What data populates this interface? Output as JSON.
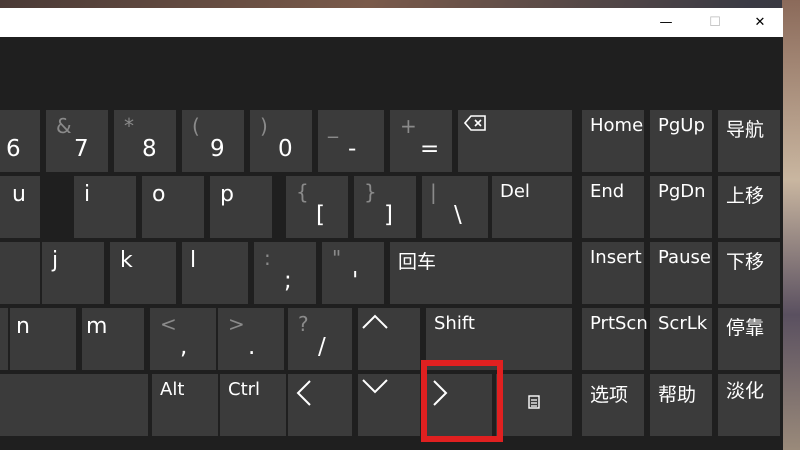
{
  "window": {
    "minimize_glyph": "—",
    "maximize_glyph": "☐",
    "close_glyph": "✕"
  },
  "keys": {
    "k6": {
      "bottom": "6"
    },
    "k7": {
      "top": "&",
      "bottom": "7"
    },
    "k8": {
      "top": "*",
      "bottom": "8"
    },
    "k9": {
      "top": "(",
      "bottom": "9"
    },
    "k0": {
      "top": ")",
      "bottom": "0"
    },
    "minus": {
      "top": "_",
      "bottom": "-"
    },
    "equals": {
      "top": "+",
      "bottom": "="
    },
    "backspace": {
      "icon": "backspace-icon"
    },
    "u": {
      "label": "u"
    },
    "i": {
      "label": "i"
    },
    "o": {
      "label": "o"
    },
    "p": {
      "label": "p"
    },
    "lbracket": {
      "top": "{",
      "bottom": "["
    },
    "rbracket": {
      "top": "}",
      "bottom": "]"
    },
    "backslash": {
      "top": "|",
      "bottom": "\\"
    },
    "del": {
      "label": "Del"
    },
    "j": {
      "label": "j"
    },
    "k": {
      "label": "k"
    },
    "l": {
      "label": "l"
    },
    "semicolon": {
      "top": ":",
      "bottom": ";"
    },
    "quote": {
      "top": "\"",
      "bottom": "'"
    },
    "enter": {
      "label": "回车"
    },
    "n": {
      "label": "n"
    },
    "m": {
      "label": "m"
    },
    "comma": {
      "top": "<",
      "bottom": ","
    },
    "period": {
      "top": ">",
      "bottom": "."
    },
    "slash": {
      "top": "?",
      "bottom": "/"
    },
    "up": {
      "glyph": "^"
    },
    "shift": {
      "label": "Shift"
    },
    "alt": {
      "label": "Alt"
    },
    "ctrl": {
      "label": "Ctrl"
    },
    "left": {
      "glyph": "<"
    },
    "down": {
      "glyph": "v"
    },
    "right": {
      "glyph": ">"
    },
    "menu": {
      "glyph": "▤"
    }
  },
  "nav_keys": {
    "home": "Home",
    "pgup": "PgUp",
    "nav": "导航",
    "end": "End",
    "pgdn": "PgDn",
    "move_up": "上移",
    "insert": "Insert",
    "pause": "Pause",
    "move_down": "下移",
    "prtscn": "PrtScn",
    "scrlk": "ScrLk",
    "dock": "停靠",
    "options": "选项",
    "help": "帮助",
    "fade": "淡化"
  },
  "colors": {
    "key_bg": "#3b3b3b",
    "panel_bg": "#1f1f1f",
    "highlight": "#e02020"
  }
}
